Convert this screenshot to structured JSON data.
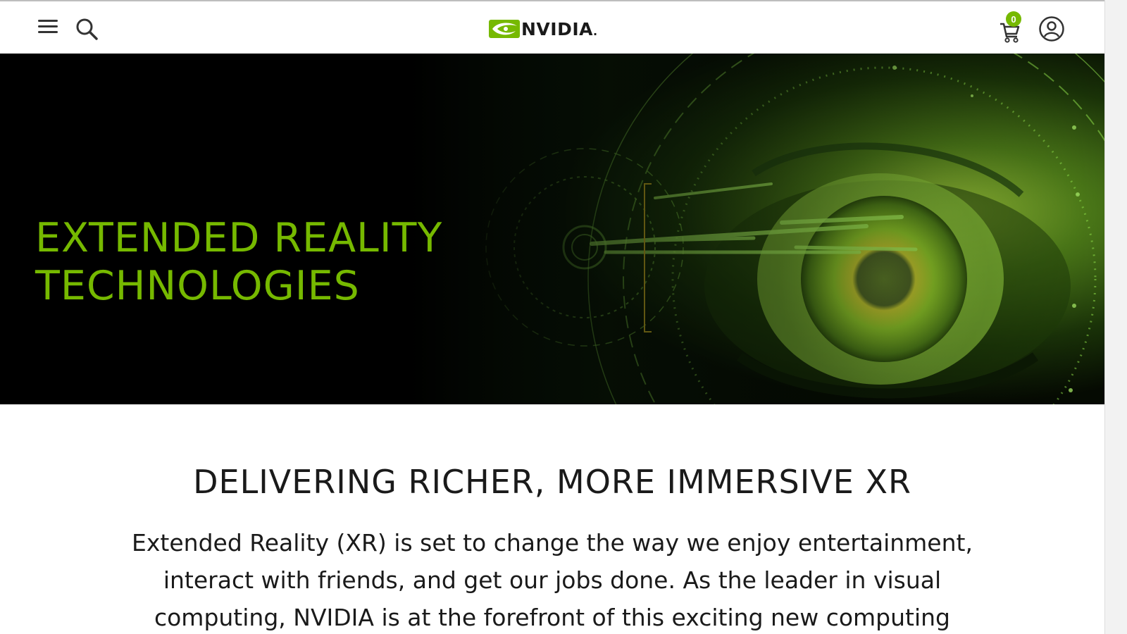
{
  "header": {
    "brand": "NVIDIA",
    "brand_suffix": ".",
    "cart_count": "0",
    "icons": [
      "menu-icon",
      "search-icon",
      "nvidia-eye-logo",
      "cart-icon",
      "account-icon"
    ]
  },
  "hero": {
    "title_line1": "EXTENDED REALITY",
    "title_line2": "TECHNOLOGIES",
    "title_color": "#76b900",
    "image": "green-eye-hud-image"
  },
  "intro": {
    "heading": "DELIVERING RICHER, MORE IMMERSIVE XR",
    "body": "Extended Reality (XR) is set to change the way we enjoy entertainment, interact with friends, and get our jobs done. As the leader in visual computing, NVIDIA is at the forefront of this exciting new computing"
  },
  "colors": {
    "accent": "#76b900",
    "text": "#1a1a1a",
    "hero_bg": "#000000"
  }
}
